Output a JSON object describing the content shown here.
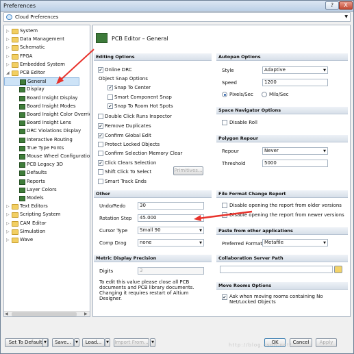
{
  "window": {
    "title": "Preferences",
    "help_glyph": "?",
    "close_glyph": "X"
  },
  "combo": {
    "value": "Cloud Preferences"
  },
  "tree": {
    "items": [
      {
        "label": "System",
        "level": 0,
        "expanded": false
      },
      {
        "label": "Data Management",
        "level": 0,
        "expanded": false
      },
      {
        "label": "Schematic",
        "level": 0,
        "expanded": false
      },
      {
        "label": "FPGA",
        "level": 0,
        "expanded": false
      },
      {
        "label": "Embedded System",
        "level": 0,
        "expanded": false
      },
      {
        "label": "PCB Editor",
        "level": 0,
        "expanded": true
      },
      {
        "label": "General",
        "level": 1,
        "selected": true
      },
      {
        "label": "Display",
        "level": 1
      },
      {
        "label": "Board Insight Display",
        "level": 1
      },
      {
        "label": "Board Insight Modes",
        "level": 1
      },
      {
        "label": "Board Insight Color Overrid",
        "level": 1
      },
      {
        "label": "Board Insight Lens",
        "level": 1
      },
      {
        "label": "DRC Violations Display",
        "level": 1
      },
      {
        "label": "Interactive Routing",
        "level": 1
      },
      {
        "label": "True Type Fonts",
        "level": 1
      },
      {
        "label": "Mouse Wheel Configuration",
        "level": 1
      },
      {
        "label": "PCB Legacy 3D",
        "level": 1
      },
      {
        "label": "Defaults",
        "level": 1
      },
      {
        "label": "Reports",
        "level": 1
      },
      {
        "label": "Layer Colors",
        "level": 1
      },
      {
        "label": "Models",
        "level": 1
      },
      {
        "label": "Text Editors",
        "level": 0,
        "expanded": false
      },
      {
        "label": "Scripting System",
        "level": 0,
        "expanded": false
      },
      {
        "label": "CAM Editor",
        "level": 0,
        "expanded": false
      },
      {
        "label": "Simulation",
        "level": 0,
        "expanded": false
      },
      {
        "label": "Wave",
        "level": 0,
        "expanded": false
      }
    ]
  },
  "page": {
    "title": "PCB Editor – General"
  },
  "editing": {
    "header": "Editing Options",
    "online_drc": "Online DRC",
    "object_snap": "Object Snap Options",
    "snap_center": "Snap To Center",
    "smart_snap": "Smart Component Snap",
    "snap_room": "Snap To Room Hot Spots",
    "double_click": "Double Click Runs Inspector",
    "remove_dup": "Remove Duplicates",
    "confirm_global": "Confirm Global Edit",
    "protect_locked": "Protect Locked Objects",
    "confirm_sel_mem": "Confirm Selection Memory Clear",
    "click_clears": "Click Clears Selection",
    "shift_click": "Shift Click To Select",
    "primitives": "Primitives...",
    "smart_track": "Smart Track Ends"
  },
  "other": {
    "header": "Other",
    "undo_label": "Undo/Redo",
    "undo_value": "30",
    "rot_label": "Rotation Step",
    "rot_value": "45.000",
    "cursor_label": "Cursor Type",
    "cursor_value": "Small 90",
    "comp_label": "Comp Drag",
    "comp_value": "none"
  },
  "metric": {
    "header": "Metric Display Precision",
    "digits_label": "Digits",
    "digits_value": "3",
    "note": "To edit this value please close all PCB documents and PCB library documents. Changing it requires restart of Altium Designer."
  },
  "autopan": {
    "header": "Autopan Options",
    "style_label": "Style",
    "style_value": "Adaptive",
    "speed_label": "Speed",
    "speed_value": "1200",
    "pixels": "Pixels/Sec",
    "mils": "Mils/Sec"
  },
  "spacenav": {
    "header": "Space Navigator Options",
    "disable_roll": "Disable Roll"
  },
  "polygon": {
    "header": "Polygon Repour",
    "repour_label": "Repour",
    "repour_value": "Never",
    "threshold_label": "Threshold",
    "threshold_value": "5000"
  },
  "fileformat": {
    "header": "File Format Change Report",
    "older": "Disable opening the report from older versions",
    "newer": "Disable opening the report from newer versions"
  },
  "paste": {
    "header": "Paste from other applications",
    "pref_label": "Preferred Format",
    "pref_value": "Metafile"
  },
  "collab": {
    "header": "Collaboration Server Path"
  },
  "moverooms": {
    "header": "Move Rooms Options",
    "ask": "Ask when moving rooms containing No Net/Locked Objects"
  },
  "footer": {
    "set_defaults": "Set To Defaults",
    "save": "Save...",
    "load": "Load...",
    "import": "Import From...",
    "ok": "OK",
    "cancel": "Cancel",
    "apply": "Apply"
  },
  "watermark": "http://blog.csdn.net/"
}
